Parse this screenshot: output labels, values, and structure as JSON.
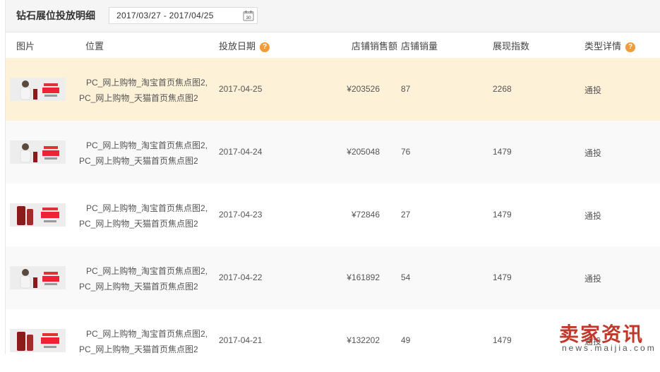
{
  "header": {
    "title": "钻石展位投放明细",
    "date_range": "2017/03/27 - 2017/04/25",
    "calendar_day": "30"
  },
  "columns": {
    "image": "图片",
    "position": "位置",
    "date": "投放日期",
    "sales": "店铺销售额",
    "volume": "店铺销量",
    "index": "展现指数",
    "type": "类型详情",
    "help": "?"
  },
  "rows": [
    {
      "pos1": "PC_网上购物_淘宝首页焦点图2,",
      "pos2": "PC_网上购物_天猫首页焦点图2",
      "date": "2017-04-25",
      "sales": "¥203526",
      "volume": "87",
      "index": "2268",
      "type": "通投"
    },
    {
      "pos1": "PC_网上购物_淘宝首页焦点图2,",
      "pos2": "PC_网上购物_天猫首页焦点图2",
      "date": "2017-04-24",
      "sales": "¥205048",
      "volume": "76",
      "index": "1479",
      "type": "通投"
    },
    {
      "pos1": "PC_网上购物_淘宝首页焦点图2,",
      "pos2": "PC_网上购物_天猫首页焦点图2",
      "date": "2017-04-23",
      "sales": "¥72846",
      "volume": "27",
      "index": "1479",
      "type": "通投"
    },
    {
      "pos1": "PC_网上购物_淘宝首页焦点图2,",
      "pos2": "PC_网上购物_天猫首页焦点图2",
      "date": "2017-04-22",
      "sales": "¥161892",
      "volume": "54",
      "index": "1479",
      "type": "通投"
    },
    {
      "pos1": "PC_网上购物_淘宝首页焦点图2,",
      "pos2": "PC_网上购物_天猫首页焦点图2",
      "date": "2017-04-21",
      "sales": "¥132202",
      "volume": "49",
      "index": "1479",
      "type": "通投"
    }
  ],
  "watermark": {
    "main": "卖家资讯",
    "sub": "news.maijia.com"
  },
  "colors": {
    "highlight_row": "#fdf1d8",
    "help_badge": "#f29b39",
    "watermark": "#c0392b"
  }
}
